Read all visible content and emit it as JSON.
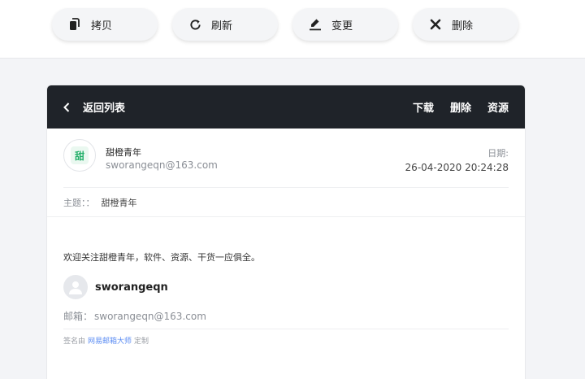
{
  "toolbar": {
    "copy_label": "拷贝",
    "refresh_label": "刷新",
    "change_label": "变更",
    "delete_label": "删除"
  },
  "header": {
    "back_label": "返回列表",
    "download_label": "下载",
    "delete_label": "删除",
    "resource_label": "资源"
  },
  "mail": {
    "sender_logo_text": "甜",
    "sender_name": "甜橙青年",
    "sender_email": "sworangeqn@163.com",
    "date_label": "日期:",
    "date_value": "26-04-2020 20:24:28",
    "subject_label": "主题：：",
    "subject_value": "甜橙青年",
    "body_text": "欢迎关注甜橙青年，软件、资源、干货一应俱全。",
    "signature_name": "sworangeqn",
    "signature_email_label": "邮箱：",
    "signature_email": "sworangeqn@163.com",
    "signed_by_prefix": "签名由",
    "signed_by_link": "网易邮箱大师",
    "signed_by_suffix": "定制"
  },
  "colors": {
    "header_bg": "#1f2329",
    "link": "#5b8cf3",
    "logo_green": "#25b06b"
  },
  "icons": [
    "copy-icon",
    "refresh-icon",
    "edit-icon",
    "close-icon",
    "chevron-left-icon",
    "user-icon"
  ]
}
